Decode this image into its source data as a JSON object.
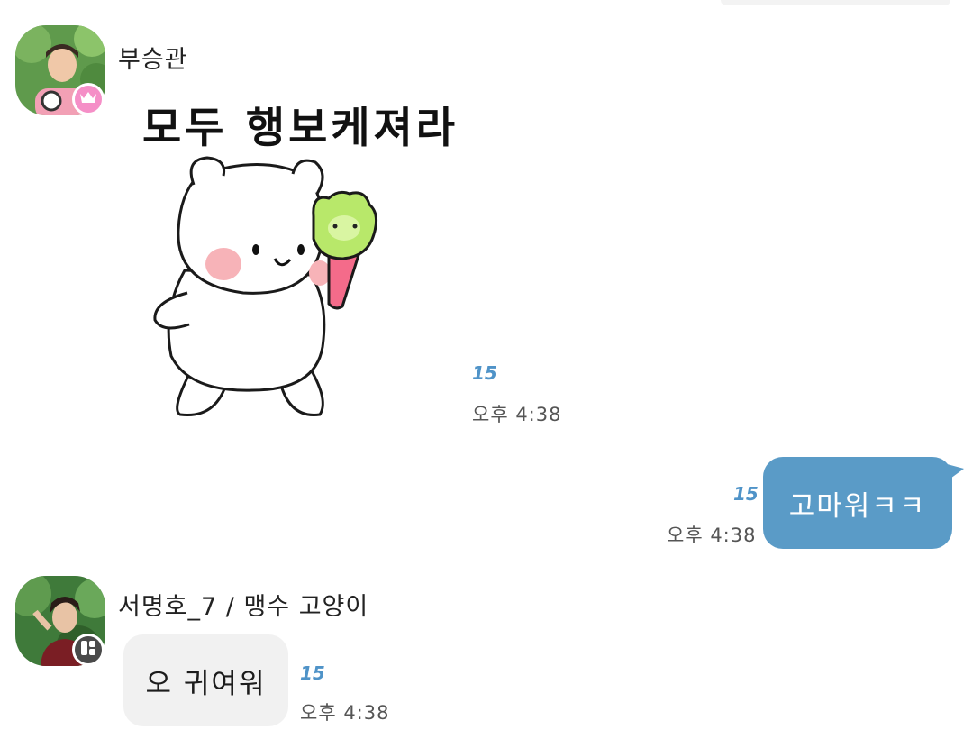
{
  "messages": {
    "first": {
      "sender": "부승관",
      "sticker_caption": "모두 행보케져라",
      "unread": "15",
      "time": "오후 4:38"
    },
    "mine": {
      "text": "고마워ㅋㅋ",
      "unread": "15",
      "time": "오후 4:38"
    },
    "second": {
      "sender": "서명호_7 / 맹수 고양이",
      "text": "오 귀여워",
      "unread": "15",
      "time": "오후 4:38"
    }
  },
  "colors": {
    "outgoing_bubble": "#5a9bc7",
    "incoming_bubble": "#f1f1f1",
    "unread_count": "#4f93c8",
    "crown_badge": "#f58fc7",
    "grid_badge": "#4a4a4a"
  },
  "icons": [
    "crown-icon",
    "grid-icon"
  ]
}
